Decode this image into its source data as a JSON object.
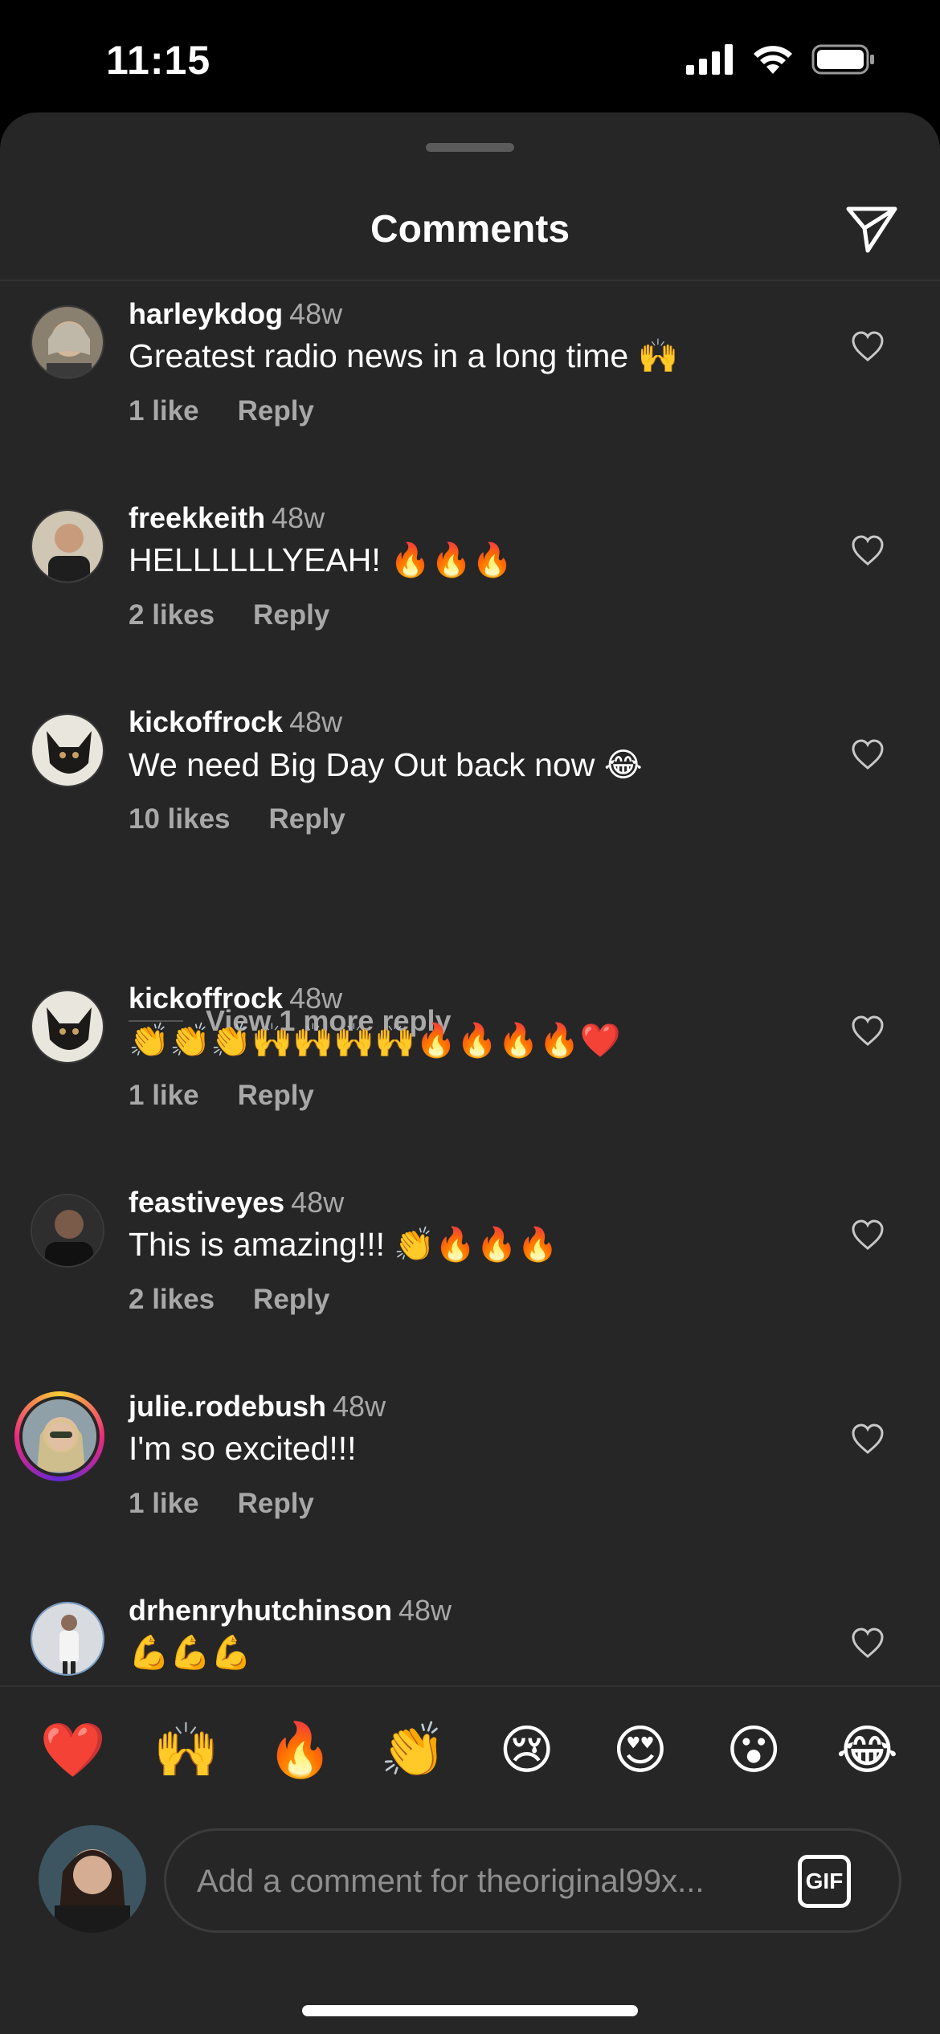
{
  "status_bar": {
    "time": "11:15"
  },
  "sheet": {
    "title": "Comments"
  },
  "comments": [
    {
      "username": "harleykdog",
      "age": "48w",
      "text": "Greatest radio news in a long time 🙌",
      "likes": "1 like",
      "reply": "Reply"
    },
    {
      "username": "freekkeith",
      "age": "48w",
      "text": "HELLLLLLYEAH! 🔥🔥🔥",
      "likes": "2 likes",
      "reply": "Reply"
    },
    {
      "username": "kickoffrock",
      "age": "48w",
      "text": "We need Big Day Out back now 😂",
      "likes": "10 likes",
      "reply": "Reply"
    },
    {
      "username": "kickoffrock",
      "age": "48w",
      "text": "👏👏👏🙌🙌🙌🙌🔥🔥🔥🔥❤️",
      "likes": "1 like",
      "reply": "Reply"
    },
    {
      "username": "feastiveyes",
      "age": "48w",
      "text": "This is amazing!!! 👏🔥🔥🔥",
      "likes": "2 likes",
      "reply": "Reply"
    },
    {
      "username": "julie.rodebush",
      "age": "48w",
      "text": "I'm so excited!!!",
      "likes": "1 like",
      "reply": "Reply"
    },
    {
      "username": "drhenryhutchinson",
      "age": "48w",
      "text": "💪💪💪",
      "likes": "",
      "reply": ""
    }
  ],
  "view_more_replies": "View 1 more reply",
  "quick_emojis": [
    "❤️",
    "🙌",
    "🔥",
    "👏",
    "😢",
    "😍",
    "😮",
    "😂"
  ],
  "composer": {
    "placeholder": "Add a comment for theoriginal99x...",
    "gif_label": "GIF"
  },
  "colors": {
    "background": "#262626",
    "text_secondary": "#a8a8a8"
  }
}
